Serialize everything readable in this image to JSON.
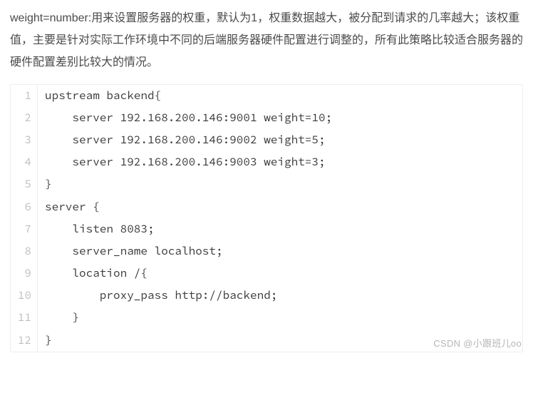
{
  "description": "weight=number:用来设置服务器的权重，默认为1，权重数据越大，被分配到请求的几率越大；该权重值，主要是针对实际工作环境中不同的后端服务器硬件配置进行调整的，所有此策略比较适合服务器的硬件配置差别比较大的情况。",
  "code": {
    "lines": [
      "upstream backend{",
      "    server 192.168.200.146:9001 weight=10;",
      "    server 192.168.200.146:9002 weight=5;",
      "    server 192.168.200.146:9003 weight=3;",
      "}",
      "server {",
      "    listen 8083;",
      "    server_name localhost;",
      "    location /{",
      "        proxy_pass http://backend;",
      "    }",
      "}"
    ],
    "numbers": [
      "1",
      "2",
      "3",
      "4",
      "5",
      "6",
      "7",
      "8",
      "9",
      "10",
      "11",
      "12"
    ]
  },
  "watermark": "CSDN @小跟班儿oo"
}
